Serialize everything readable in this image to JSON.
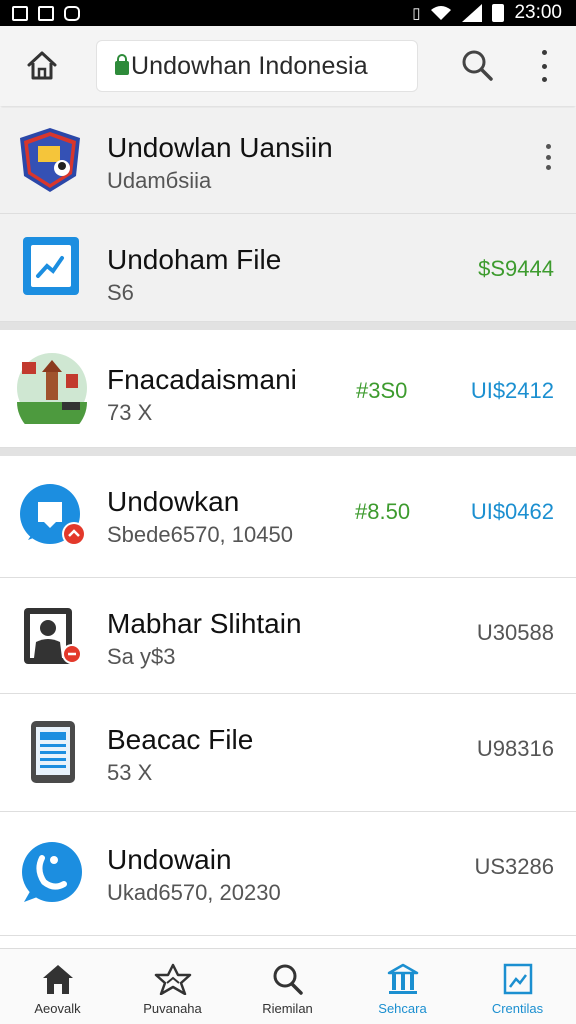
{
  "status_bar": {
    "time": "23:00",
    "icons": [
      "image-icon",
      "photo-icon",
      "chat-icon",
      "vibrate-icon",
      "wifi-icon",
      "signal-icon",
      "battery-icon"
    ]
  },
  "toolbar": {
    "url": "Undowhan Indonesia",
    "icons": [
      "home-icon",
      "lock-icon",
      "search-icon",
      "more-vert-icon"
    ]
  },
  "list": [
    {
      "title": "Undowlan Uansiin",
      "subtitle": "Udamбsiia",
      "icon": "shield-app-icon"
    },
    {
      "title": "Undoham File",
      "subtitle": "S6",
      "price": "$S9444",
      "icon": "chart-file-icon"
    },
    {
      "title": "Fnacadaismani",
      "subtitle": "73 X",
      "price": "#3S0",
      "price_alt": "UI$2412",
      "icon": "temple-app-icon"
    },
    {
      "title": "Undowkan",
      "subtitle": "Sbede6570, 10450",
      "price": "#8.50",
      "price_alt": "UI$0462",
      "icon": "message-app-icon"
    },
    {
      "title": "Mabhar Slihtain",
      "subtitle": "Sa y$3",
      "price": "U30588",
      "icon": "person-app-icon"
    },
    {
      "title": "Beacac File",
      "subtitle": "53 X",
      "price": "U98316",
      "icon": "tablet-app-icon"
    },
    {
      "title": "Undowain",
      "subtitle": "Ukad6570, 20230",
      "price": "US3286",
      "icon": "phone-bubble-app-icon"
    }
  ],
  "bottom_nav": [
    {
      "label": "Aeovalk",
      "icon": "home-icon",
      "active": false
    },
    {
      "label": "Puvanaha",
      "icon": "star-icon",
      "active": false
    },
    {
      "label": "Riemilan",
      "icon": "search-icon",
      "active": false
    },
    {
      "label": "Sehcara",
      "icon": "bank-icon",
      "active": true
    },
    {
      "label": "Crentilas",
      "icon": "image-icon",
      "active": true
    }
  ],
  "colors": {
    "price_green": "#3d9b2e",
    "price_blue": "#1b8fd0",
    "nav_active": "#1b8fd0",
    "toolbar_bg": "#f4f4f4"
  }
}
